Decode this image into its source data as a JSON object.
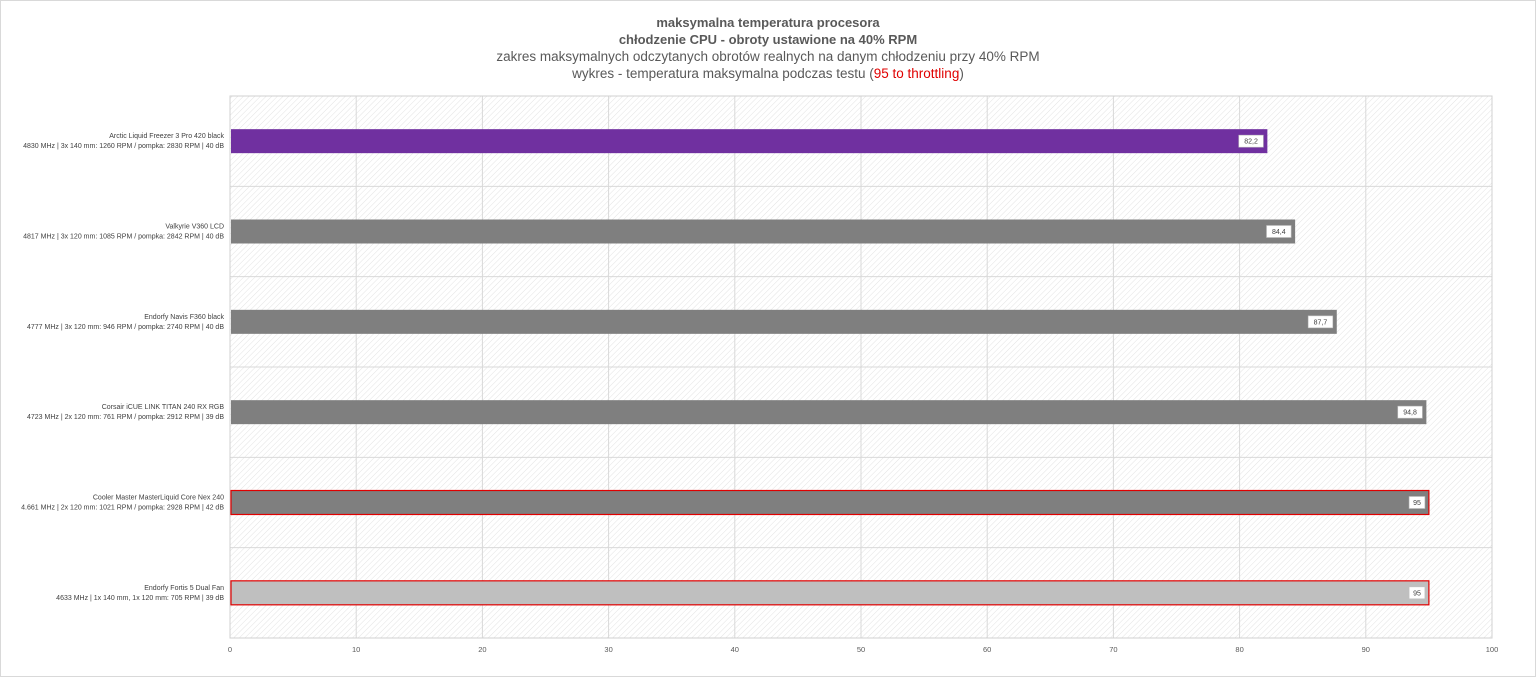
{
  "titles": {
    "line1": "maksymalna temperatura procesora",
    "line2": "chłodzenie CPU - obroty ustawione na 40% RPM",
    "line3": "zakres maksymalnych odczytanych obrotów realnych na danym chłodzeniu przy 40% RPM",
    "line4_prefix": "wykres - temperatura maksymalna podczas testu (",
    "line4_highlight": "95 to throttling",
    "line4_suffix": ")"
  },
  "colors": {
    "purple": "#7030a0",
    "gray": "#7f7f7f",
    "light_gray": "#bfbfbf",
    "highlight_border": "#e00000",
    "grid": "#d9d9d9"
  },
  "chart_data": {
    "type": "bar",
    "orientation": "horizontal",
    "categories": [
      {
        "name": "Arctic Liquid Freezer 3 Pro 420 black",
        "detail": "4830 MHz | 3x 140 mm: 1260 RPM / pompka: 2830 RPM | 40 dB"
      },
      {
        "name": "Valkyrie V360 LCD",
        "detail": "4817 MHz  |  3x 120 mm: 1085 RPM / pompka: 2842 RPM | 40 dB"
      },
      {
        "name": "Endorfy Navis F360 black",
        "detail": "4777 MHz  |  3x 120 mm: 946 RPM / pompka: 2740 RPM | 40 dB"
      },
      {
        "name": "Corsair iCUE LINK TITAN 240 RX RGB",
        "detail": "4723 MHz  |  2x 120 mm: 761 RPM / pompka: 2912 RPM | 39 dB"
      },
      {
        "name": "Cooler Master MasterLiquid Core Nex 240",
        "detail": "4.661 MHz  |  2x 120 mm: 1021 RPM / pompka: 2928 RPM | 42 dB"
      },
      {
        "name": "Endorfy Fortis 5 Dual Fan",
        "detail": "4633 MHz | 1x 140 mm, 1x 120 mm: 705 RPM | 39 dB"
      }
    ],
    "values": [
      82.2,
      84.4,
      87.7,
      94.8,
      95,
      95
    ],
    "value_labels": [
      "82,2",
      "84,4",
      "87,7",
      "94,8",
      "95",
      "95"
    ],
    "bar_colors": [
      "#7030a0",
      "#7f7f7f",
      "#7f7f7f",
      "#7f7f7f",
      "#7f7f7f",
      "#bfbfbf"
    ],
    "highlighted": [
      false,
      false,
      false,
      false,
      true,
      true
    ],
    "xlim": [
      0,
      100
    ],
    "xticks": [
      0,
      10,
      20,
      30,
      40,
      50,
      60,
      70,
      80,
      90,
      100
    ],
    "grid": true,
    "legend": "none"
  }
}
